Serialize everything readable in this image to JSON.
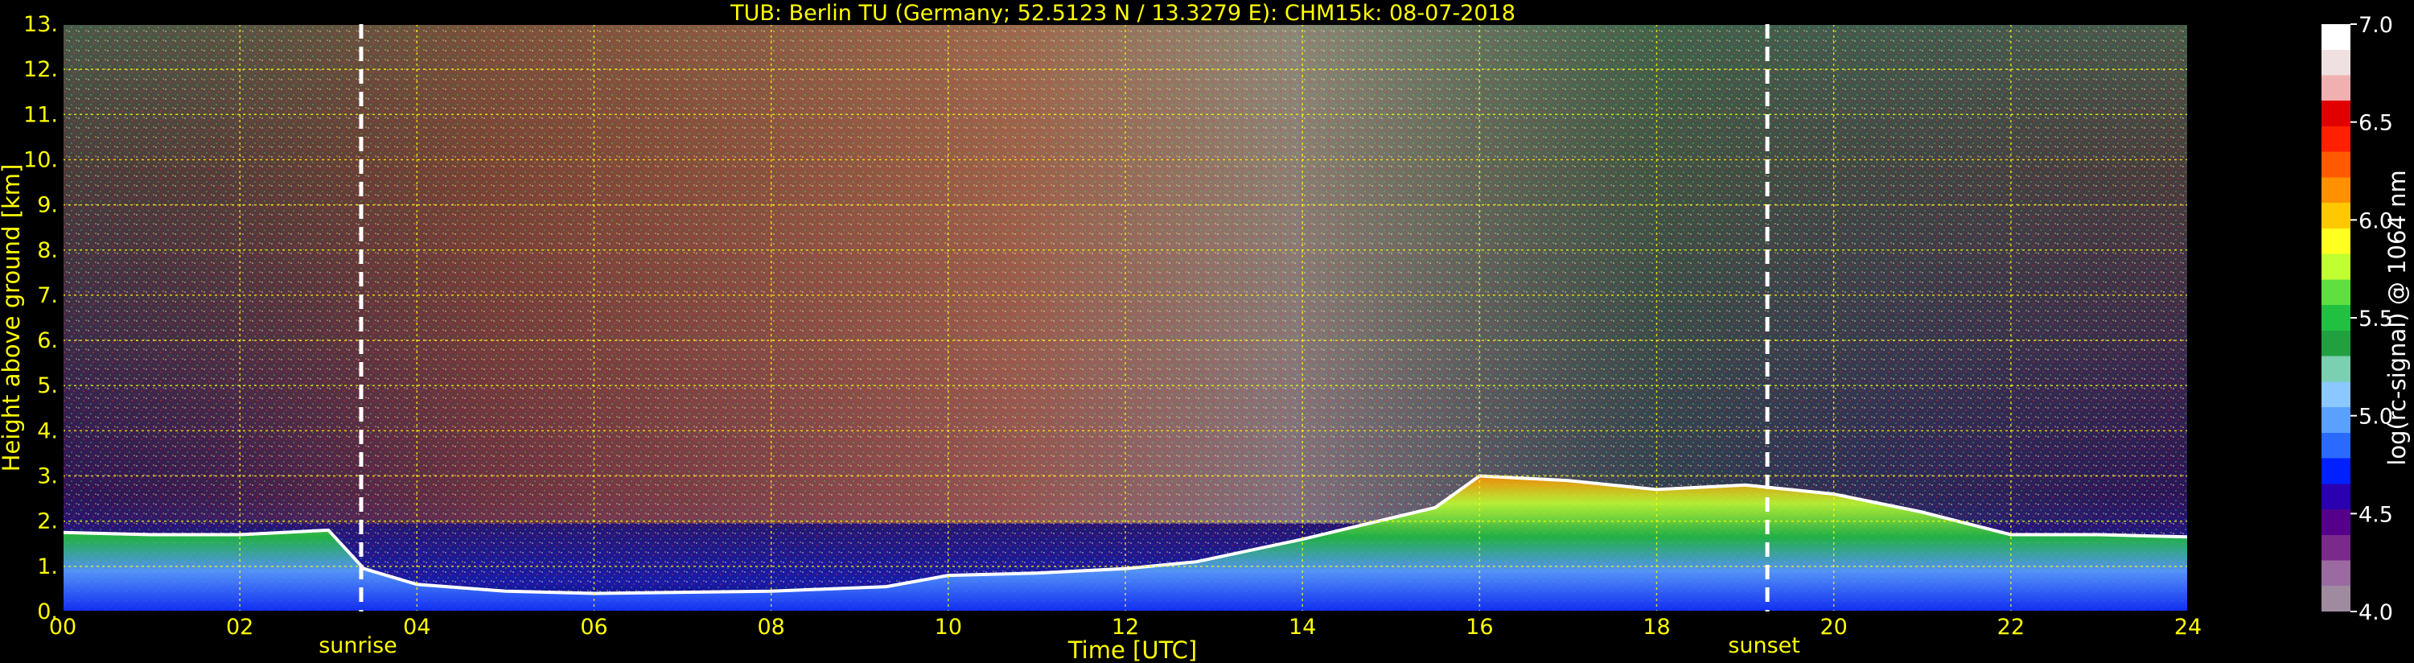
{
  "chart_data": {
    "type": "heatmap",
    "title": "TUB: Berlin TU (Germany; 52.5123 N / 13.3279 E):    CHM15k: 08-07-2018",
    "xlabel": "Time [UTC]",
    "ylabel": "Height above ground [km]",
    "xlim": [
      0,
      24
    ],
    "ylim": [
      0,
      13
    ],
    "x_ticks": [
      "00",
      "02",
      "04",
      "06",
      "08",
      "10",
      "12",
      "14",
      "16",
      "18",
      "20",
      "22",
      "24"
    ],
    "y_ticks": [
      "0.",
      "1.",
      "2.",
      "3.",
      "4.",
      "5.",
      "6.",
      "7.",
      "8.",
      "9.",
      "10.",
      "11.",
      "12.",
      "13."
    ],
    "grid": true,
    "markers": [
      {
        "label": "sunrise",
        "x": 3.37
      },
      {
        "label": "sunset",
        "x": 19.25
      }
    ],
    "boundary_layer_top_km": {
      "x": [
        0,
        1,
        2,
        3,
        3.4,
        4,
        5,
        6,
        8,
        9.3,
        10,
        11,
        12,
        12.8,
        14,
        15.5,
        16,
        17,
        18,
        19,
        20,
        21,
        22,
        23,
        24
      ],
      "y": [
        1.75,
        1.7,
        1.7,
        1.8,
        0.95,
        0.6,
        0.45,
        0.4,
        0.45,
        0.55,
        0.8,
        0.85,
        0.95,
        1.1,
        1.6,
        2.3,
        3.0,
        2.9,
        2.7,
        2.8,
        2.6,
        2.2,
        1.7,
        1.7,
        1.65
      ]
    },
    "colorbar": {
      "label": "log(rc-signal) @ 1064 nm",
      "range": [
        4.0,
        7.0
      ],
      "ticks": [
        "4.0",
        "4.5",
        "5.0",
        "5.5",
        "6.0",
        "6.5",
        "7.0"
      ],
      "colors": [
        "#a08aa0",
        "#9a6aa0",
        "#7a2a8a",
        "#55008a",
        "#2a00b0",
        "#0020ff",
        "#2a6aff",
        "#5aa0ff",
        "#8ac8ff",
        "#7ad0b0",
        "#22a040",
        "#22c040",
        "#60e040",
        "#c0ff30",
        "#ffff20",
        "#ffc800",
        "#ff9000",
        "#ff5a00",
        "#ff2000",
        "#e00000",
        "#f0b0b0",
        "#f0e0e0",
        "#ffffff"
      ]
    }
  }
}
